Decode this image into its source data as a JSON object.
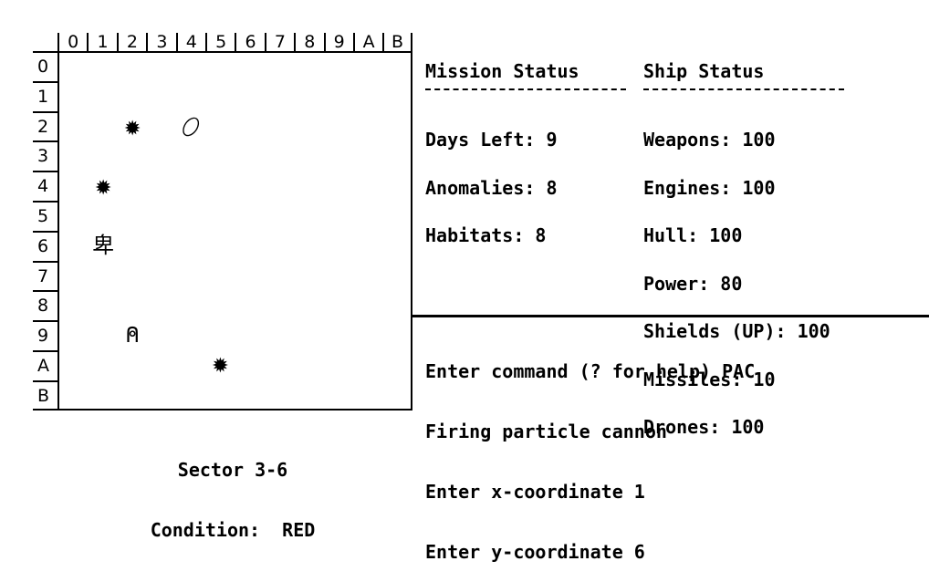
{
  "grid": {
    "columns": [
      "0",
      "1",
      "2",
      "3",
      "4",
      "5",
      "6",
      "7",
      "8",
      "9",
      "A",
      "B"
    ],
    "rows": [
      "0",
      "1",
      "2",
      "3",
      "4",
      "5",
      "6",
      "7",
      "8",
      "9",
      "A",
      "B"
    ],
    "objects": [
      {
        "type": "star",
        "col": 2,
        "row": 2,
        "glyph": "✹"
      },
      {
        "type": "anomaly",
        "col": 4,
        "row": 2,
        "glyph": "⬯"
      },
      {
        "type": "star",
        "col": 1,
        "row": 4,
        "glyph": "✹"
      },
      {
        "type": "ship",
        "col": 1,
        "row": 6,
        "glyph": "卑"
      },
      {
        "type": "habitat",
        "col": 2,
        "row": 9,
        "glyph": "⍝"
      },
      {
        "type": "star",
        "col": 5,
        "row": 10,
        "glyph": "✹"
      }
    ]
  },
  "mission_status": {
    "title": "Mission Status",
    "rule": "-------------",
    "items": [
      "Days Left: 9",
      "Anomalies: 8",
      "Habitats: 8"
    ]
  },
  "ship_status": {
    "title": "Ship Status",
    "rule": "------------",
    "items": [
      "Weapons: 100",
      "Engines: 100",
      "Hull: 100",
      "Power: 80",
      "Shields (UP): 100",
      "Missiles: 10",
      "Drones: 100"
    ]
  },
  "console": {
    "lines": [
      "Enter command (? for help) PAC",
      "Firing particle cannon",
      "Enter x-coordinate 1",
      "Enter y-coordinate 6"
    ]
  },
  "footer": {
    "sector": "Sector 3-6",
    "condition": "Condition:  RED"
  }
}
